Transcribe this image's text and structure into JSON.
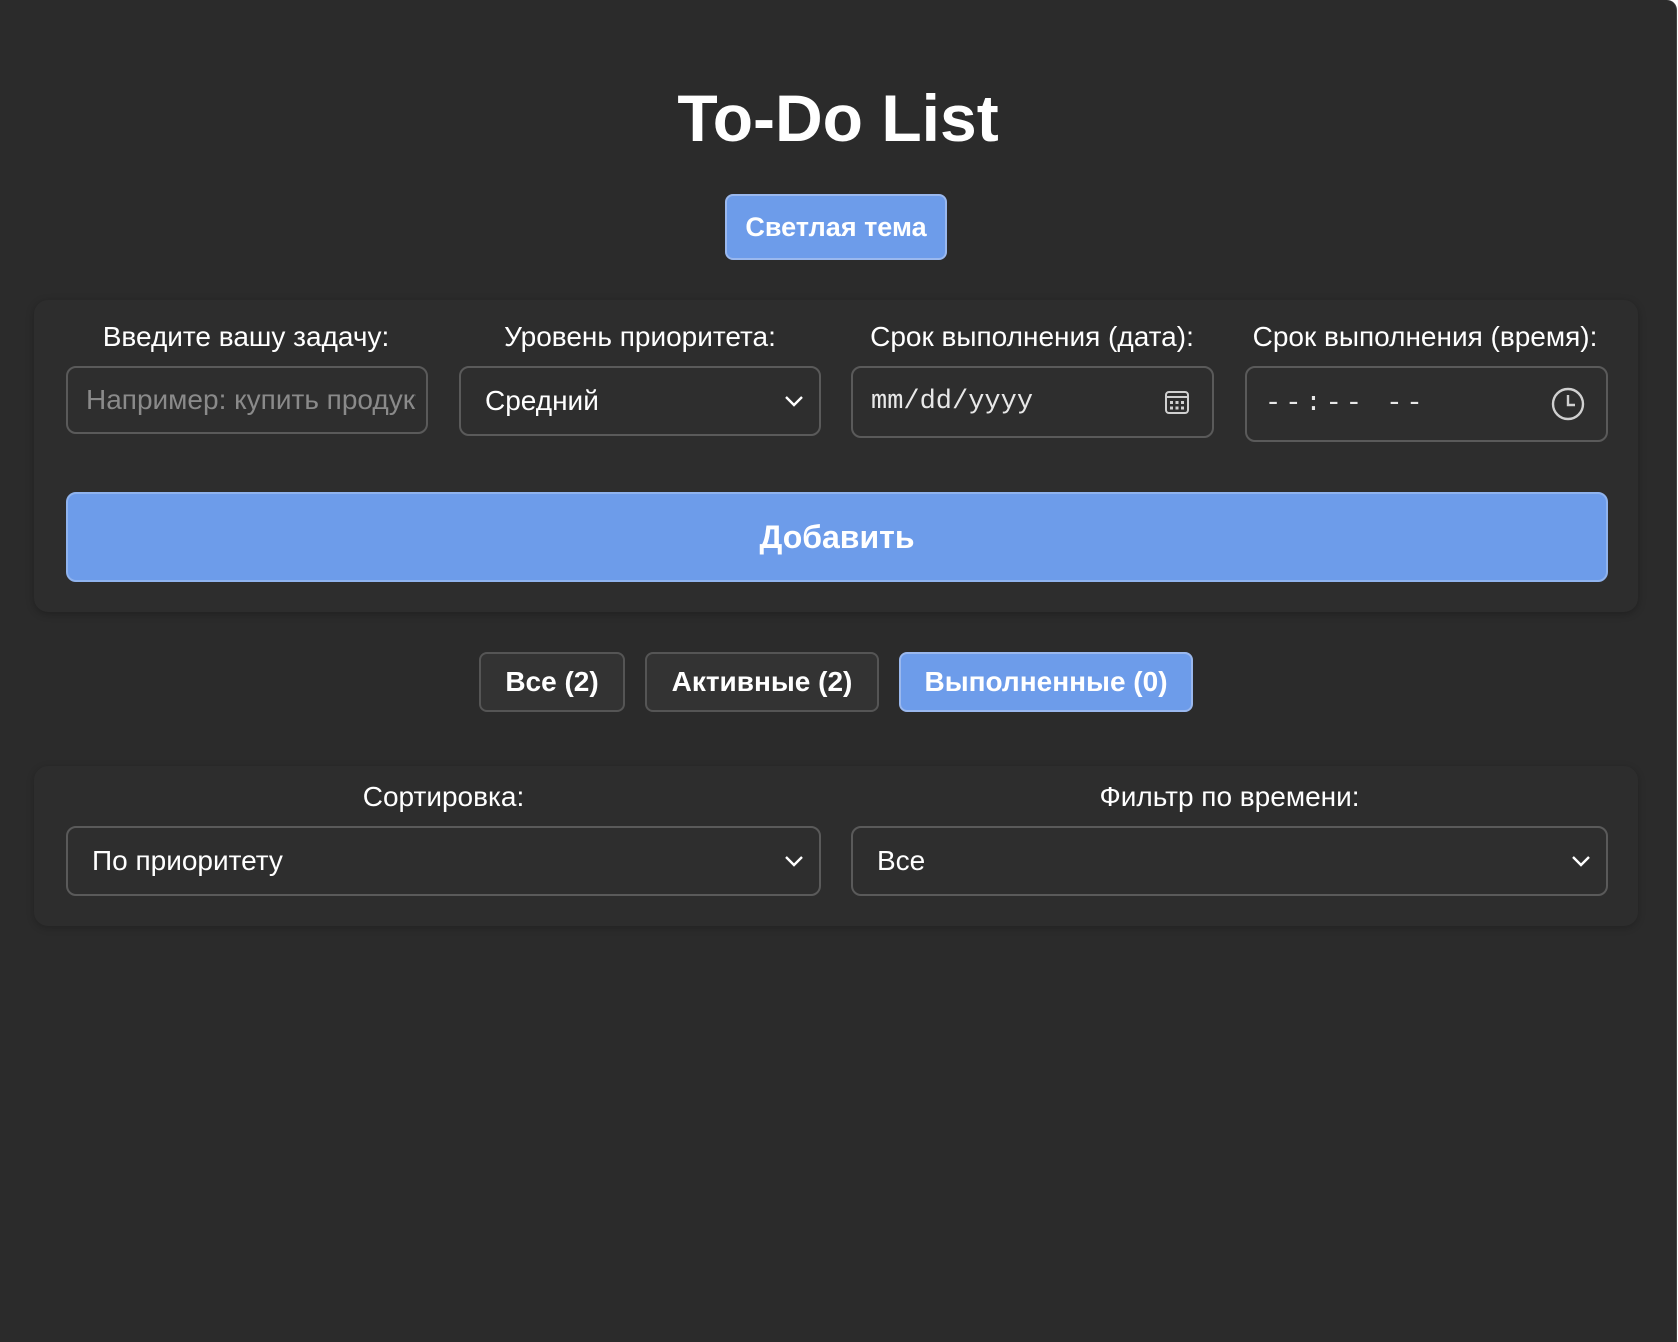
{
  "app": {
    "title": "To-Do List",
    "theme_toggle_label": "Светлая тема",
    "accent_color": "#6d9cea",
    "background_color": "#2b2b2b"
  },
  "form": {
    "task_label": "Введите вашу задачу:",
    "task_placeholder": "Например: купить продукт",
    "priority_label": "Уровень приоритета:",
    "priority_value": "Средний",
    "date_label": "Срок выполнения (дата):",
    "date_placeholder": "mm/dd/yyyy",
    "time_label": "Срок выполнения (время):",
    "time_placeholder": "--:-- --",
    "add_button": "Добавить",
    "icons": {
      "date": "calendar-icon",
      "time": "clock-icon",
      "select": "chevron-down-icon"
    }
  },
  "filters": [
    {
      "label": "Все (2)",
      "active": false
    },
    {
      "label": "Активные (2)",
      "active": false
    },
    {
      "label": "Выполненные (0)",
      "active": true
    }
  ],
  "controls": {
    "sort_label": "Сортировка:",
    "sort_value": "По приоритету",
    "time_filter_label": "Фильтр по времени:",
    "time_filter_value": "Все"
  }
}
